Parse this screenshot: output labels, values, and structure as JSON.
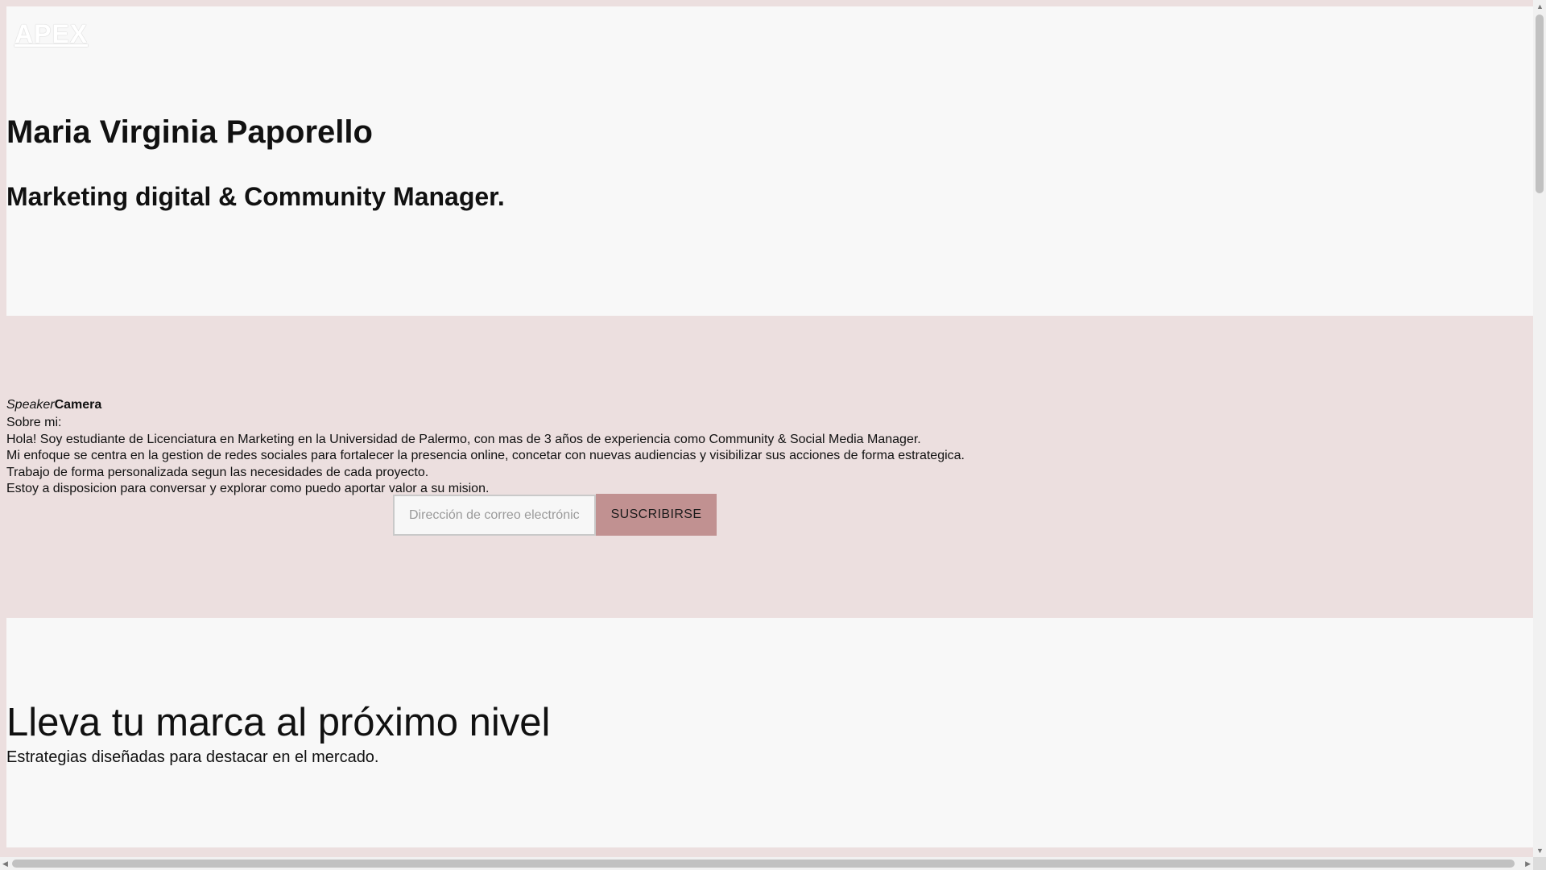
{
  "header": {
    "logo_text": "APEX"
  },
  "hero": {
    "name": "Maria Virginia Paporello",
    "role": "Marketing digital & Community Manager."
  },
  "about": {
    "media_alt_italic": "Speaker",
    "media_alt_bold": "Camera",
    "heading": "Sobre mi:",
    "paragraphs": [
      "Hola! Soy estudiante de Licenciatura en Marketing en la Universidad de Palermo, con mas de 3 años de experiencia como Community & Social Media Manager.",
      "Mi enfoque se centra en la gestion de redes sociales para fortalecer la presencia online, concetar con nuevas audiencias y visibilizar sus acciones de forma estrategica.",
      "Trabajo de forma personalizada segun las necesidades de cada proyecto.",
      "Estoy a disposicion para conversar y explorar como puedo aportar valor a su mision."
    ],
    "subscribe": {
      "placeholder": "Dirección de correo electrónico",
      "button_label": "SUSCRIBIRSE"
    }
  },
  "cta": {
    "title": "Lleva tu marca al próximo nivel",
    "subtitle": "Estrategias diseñadas para destacar en el mercado."
  },
  "scrollbars": {
    "up_icon": "arrow-up-icon",
    "down_icon": "arrow-down-icon",
    "left_icon": "arrow-left-icon",
    "right_icon": "arrow-right-icon"
  }
}
